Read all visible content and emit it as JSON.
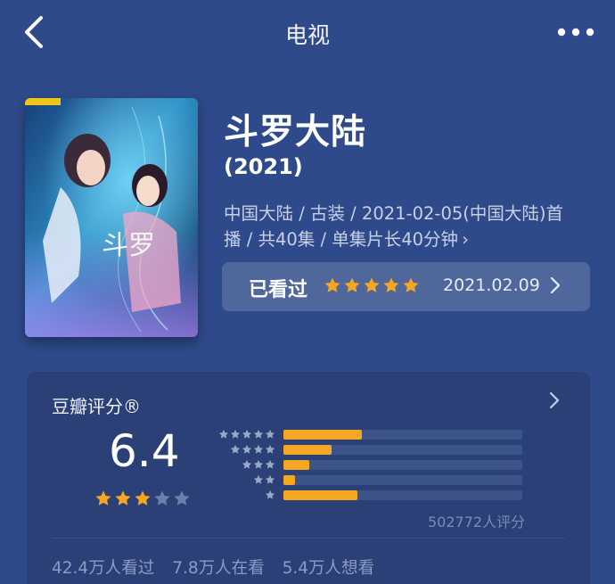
{
  "header": {
    "title": "电视",
    "back_icon": "back-chevron-icon",
    "more_icon": "more-dots-icon"
  },
  "movie": {
    "title": "斗罗大陆",
    "year": "(2021)",
    "meta_line1": "中国大陆 / 古装 / 2021-02-05(中国大陆)首",
    "meta_line2": "播 / 共40集 / 单集片长40分钟",
    "meta_chevron": "›"
  },
  "watched": {
    "label": "已看过",
    "my_rating_stars": 5,
    "date": "2021.02.09",
    "chevron": "›"
  },
  "rating": {
    "title": "豆瓣评分®",
    "chevron": "›",
    "score": "6.4",
    "score_stars": 3,
    "distribution": [
      {
        "stars": 5,
        "fraction": 0.33
      },
      {
        "stars": 4,
        "fraction": 0.2
      },
      {
        "stars": 3,
        "fraction": 0.11
      },
      {
        "stars": 2,
        "fraction": 0.05
      },
      {
        "stars": 1,
        "fraction": 0.31
      }
    ],
    "vote_count": "502772人评分"
  },
  "stats": {
    "watched": "42.4万人看过",
    "watching": "7.8万人在看",
    "wish": "5.4万人想看"
  },
  "colors": {
    "background": "#2f4a8a",
    "card": "#2a4076",
    "star_active": "#f5a623",
    "star_inactive": "#6e7fa8"
  }
}
